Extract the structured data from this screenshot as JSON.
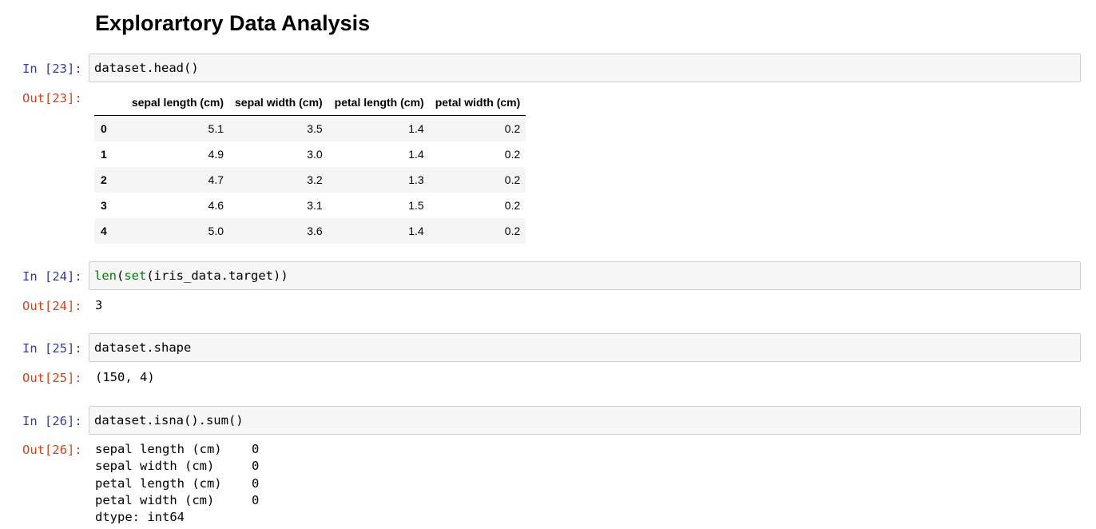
{
  "heading": "Explorartory Data Analysis",
  "cells": [
    {
      "in_prompt": "In [23]:",
      "code": "dataset.head()",
      "out_prompt": "Out[23]:",
      "output_table": {
        "columns": [
          "sepal length (cm)",
          "sepal width (cm)",
          "petal length (cm)",
          "petal width (cm)"
        ],
        "rows": [
          {
            "index": "0",
            "values": [
              "5.1",
              "3.5",
              "1.4",
              "0.2"
            ]
          },
          {
            "index": "1",
            "values": [
              "4.9",
              "3.0",
              "1.4",
              "0.2"
            ]
          },
          {
            "index": "2",
            "values": [
              "4.7",
              "3.2",
              "1.3",
              "0.2"
            ]
          },
          {
            "index": "3",
            "values": [
              "4.6",
              "3.1",
              "1.5",
              "0.2"
            ]
          },
          {
            "index": "4",
            "values": [
              "5.0",
              "3.6",
              "1.4",
              "0.2"
            ]
          }
        ]
      }
    },
    {
      "in_prompt": "In [24]:",
      "code_builtin_1": "len",
      "code_part_2": "(",
      "code_builtin_2": "set",
      "code_part_3": "(iris_data.target))",
      "out_prompt": "Out[24]:",
      "output_text": "3"
    },
    {
      "in_prompt": "In [25]:",
      "code": "dataset.shape",
      "out_prompt": "Out[25]:",
      "output_text": "(150, 4)"
    },
    {
      "in_prompt": "In [26]:",
      "code": "dataset.isna().sum()",
      "out_prompt": "Out[26]:",
      "output_lines": [
        "sepal length (cm)    0",
        "sepal width (cm)     0",
        "petal length (cm)    0",
        "petal width (cm)     0",
        "dtype: int64"
      ]
    }
  ],
  "colors": {
    "in_prompt": "#303f9f",
    "out_prompt": "#d84315",
    "builtin": "#008000",
    "input_bg": "#f7f7f7",
    "input_border": "#cfcfcf"
  }
}
